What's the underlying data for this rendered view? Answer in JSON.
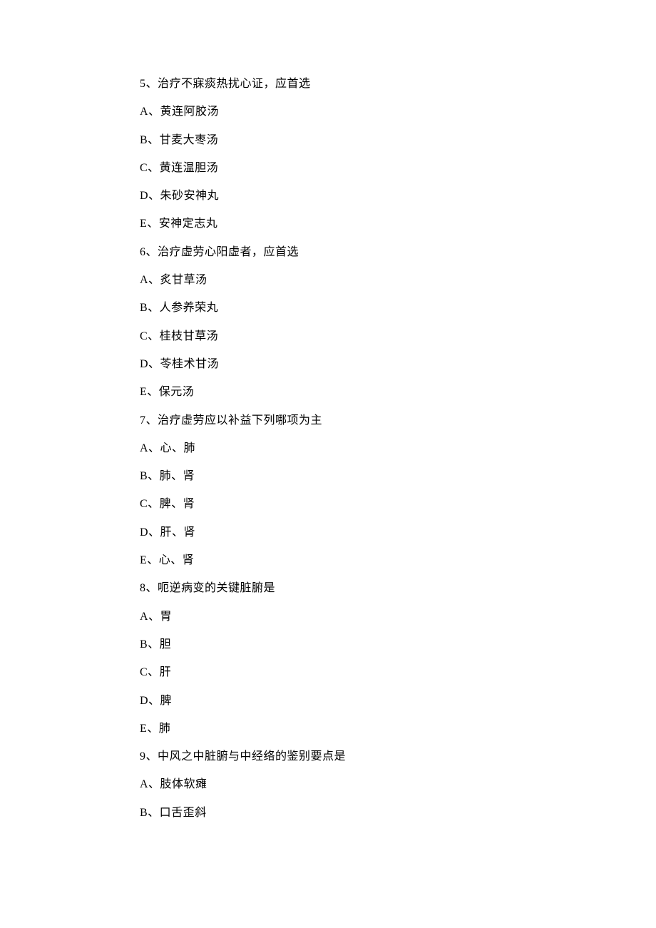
{
  "questions": [
    {
      "stem": "5、治疗不寐痰热扰心证，应首选",
      "options": [
        "A、黄连阿胶汤",
        "B、甘麦大枣汤",
        "C、黄连温胆汤",
        "D、朱砂安神丸",
        "E、安神定志丸"
      ]
    },
    {
      "stem": "6、治疗虚劳心阳虚者，应首选",
      "options": [
        "A、炙甘草汤",
        "B、人参养荣丸",
        "C、桂枝甘草汤",
        "D、苓桂术甘汤",
        "E、保元汤"
      ]
    },
    {
      "stem": "7、治疗虚劳应以补益下列哪项为主",
      "options": [
        "A、心、肺",
        "B、肺、肾",
        "C、脾、肾",
        "D、肝、肾",
        "E、心、肾"
      ]
    },
    {
      "stem": "8、呃逆病变的关键脏腑是",
      "options": [
        "A、胃",
        "B、胆",
        "C、肝",
        "D、脾",
        "E、肺"
      ]
    },
    {
      "stem": "9、中风之中脏腑与中经络的鉴别要点是",
      "options": [
        "A、肢体软瘫",
        "B、口舌歪斜"
      ]
    }
  ]
}
